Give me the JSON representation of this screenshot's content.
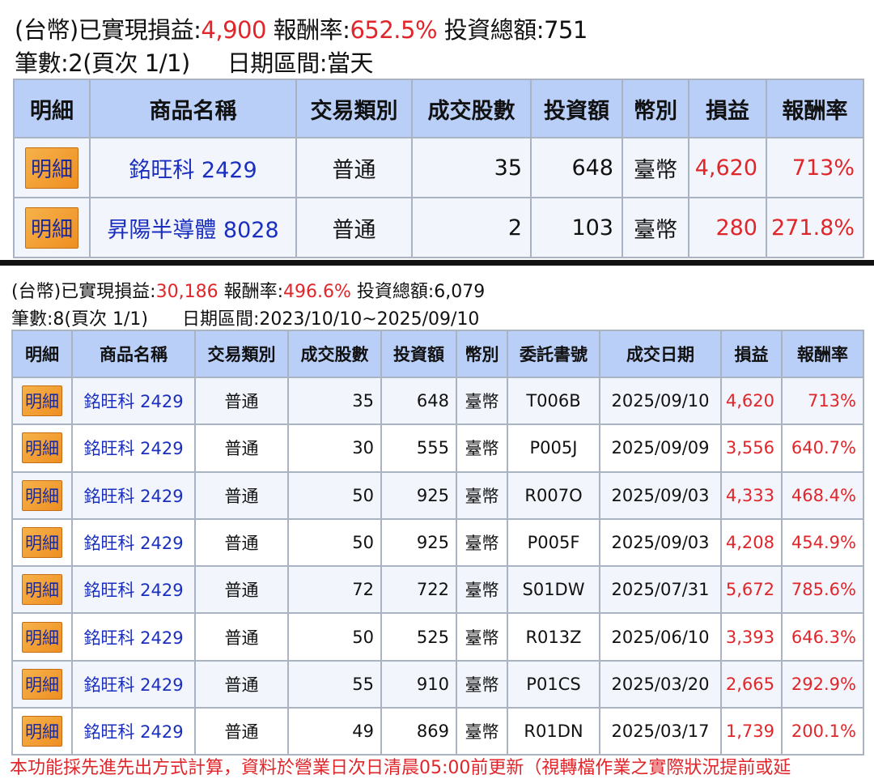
{
  "today": {
    "line1": {
      "prefix": "(台幣)已實現損益:",
      "pnl": "4,900",
      "rate_label": " 報酬率:",
      "rate": "652.5%",
      "invest_label": " 投資總額:751"
    },
    "line2": {
      "count": "筆數:2(頁次 1/1)",
      "range": "日期區間:當天"
    },
    "headers": [
      "明細",
      "商品名稱",
      "交易類別",
      "成交股數",
      "投資額",
      "幣別",
      "損益",
      "報酬率"
    ],
    "rows": [
      {
        "detail": "明細",
        "product": "銘旺科 2429",
        "type": "普通",
        "shares": "35",
        "invest": "648",
        "currency": "臺幣",
        "pnl": "4,620",
        "rate": "713%"
      },
      {
        "detail": "明細",
        "product": "昇陽半導體 8028",
        "type": "普通",
        "shares": "2",
        "invest": "103",
        "currency": "臺幣",
        "pnl": "280",
        "rate": "271.8%"
      }
    ]
  },
  "history": {
    "line1": {
      "prefix": "(台幣)已實現損益:",
      "pnl": "30,186",
      "rate_label": " 報酬率:",
      "rate": "496.6%",
      "invest_label": " 投資總額:6,079"
    },
    "line2": {
      "count": "筆數:8(頁次 1/1)",
      "range": "日期區間:2023/10/10~2025/09/10"
    },
    "headers": [
      "明細",
      "商品名稱",
      "交易類別",
      "成交股數",
      "投資額",
      "幣別",
      "委託書號",
      "成交日期",
      "損益",
      "報酬率"
    ],
    "rows": [
      {
        "detail": "明細",
        "product": "銘旺科 2429",
        "type": "普通",
        "shares": "35",
        "invest": "648",
        "currency": "臺幣",
        "order": "T006B",
        "date": "2025/09/10",
        "pnl": "4,620",
        "rate": "713%"
      },
      {
        "detail": "明細",
        "product": "銘旺科 2429",
        "type": "普通",
        "shares": "30",
        "invest": "555",
        "currency": "臺幣",
        "order": "P005J",
        "date": "2025/09/09",
        "pnl": "3,556",
        "rate": "640.7%"
      },
      {
        "detail": "明細",
        "product": "銘旺科 2429",
        "type": "普通",
        "shares": "50",
        "invest": "925",
        "currency": "臺幣",
        "order": "R007O",
        "date": "2025/09/03",
        "pnl": "4,333",
        "rate": "468.4%"
      },
      {
        "detail": "明細",
        "product": "銘旺科 2429",
        "type": "普通",
        "shares": "50",
        "invest": "925",
        "currency": "臺幣",
        "order": "P005F",
        "date": "2025/09/03",
        "pnl": "4,208",
        "rate": "454.9%"
      },
      {
        "detail": "明細",
        "product": "銘旺科 2429",
        "type": "普通",
        "shares": "72",
        "invest": "722",
        "currency": "臺幣",
        "order": "S01DW",
        "date": "2025/07/31",
        "pnl": "5,672",
        "rate": "785.6%"
      },
      {
        "detail": "明細",
        "product": "銘旺科 2429",
        "type": "普通",
        "shares": "50",
        "invest": "525",
        "currency": "臺幣",
        "order": "R013Z",
        "date": "2025/06/10",
        "pnl": "3,393",
        "rate": "646.3%"
      },
      {
        "detail": "明細",
        "product": "銘旺科 2429",
        "type": "普通",
        "shares": "55",
        "invest": "910",
        "currency": "臺幣",
        "order": "P01CS",
        "date": "2025/03/20",
        "pnl": "2,665",
        "rate": "292.9%"
      },
      {
        "detail": "明細",
        "product": "銘旺科 2429",
        "type": "普通",
        "shares": "49",
        "invest": "869",
        "currency": "臺幣",
        "order": "R01DN",
        "date": "2025/03/17",
        "pnl": "1,739",
        "rate": "200.1%"
      }
    ]
  },
  "footnote": "本功能採先進先出方式計算，資料於營業日次日清晨05:00前更新（視轉檔作業之實際狀況提前或延"
}
